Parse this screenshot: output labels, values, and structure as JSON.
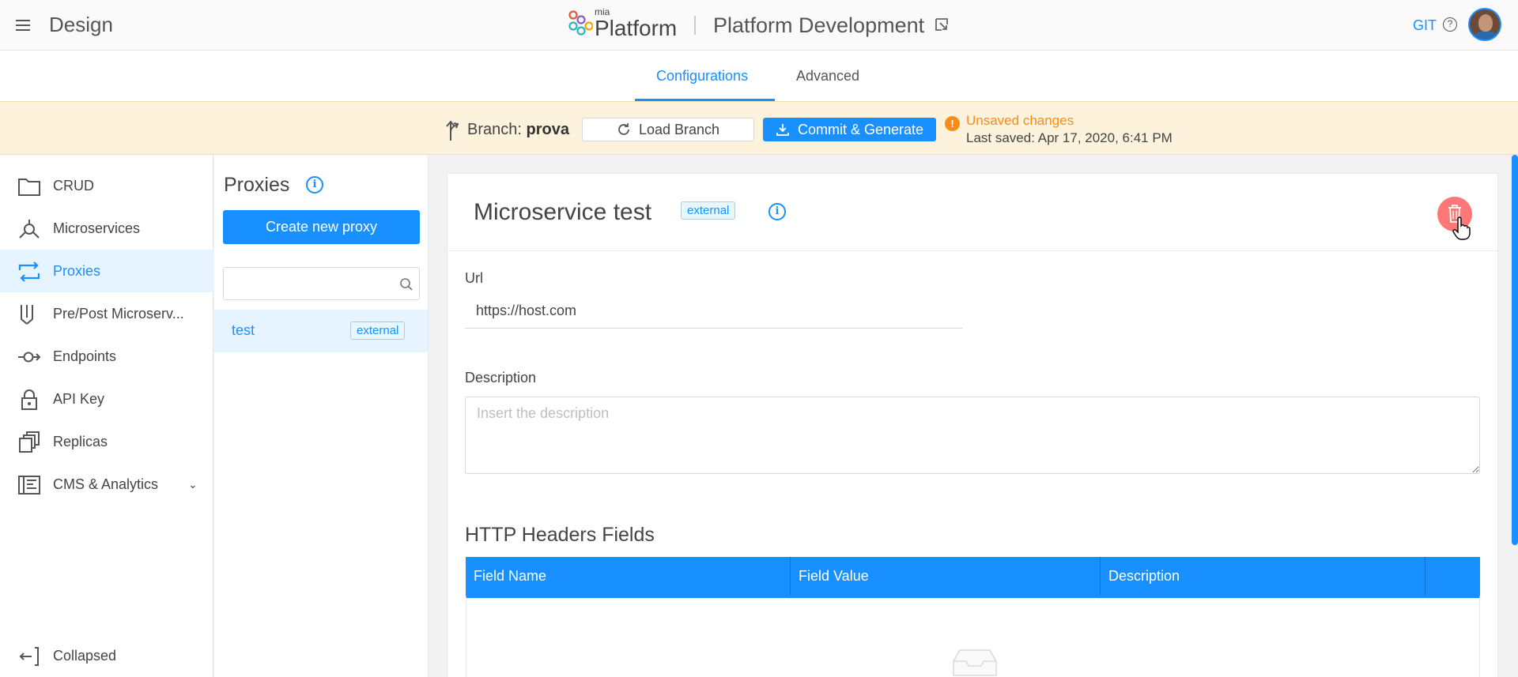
{
  "header": {
    "section_title": "Design",
    "logo_small": "mia",
    "logo_main": "Platform",
    "project_title": "Platform Development",
    "git_label": "GIT"
  },
  "tabs": [
    {
      "label": "Configurations",
      "active": true
    },
    {
      "label": "Advanced",
      "active": false
    }
  ],
  "branch_bar": {
    "branch_prefix": "Branch:",
    "branch_name": "prova",
    "load_branch_label": "Load Branch",
    "commit_label": "Commit & Generate",
    "unsaved_text": "Unsaved changes",
    "last_saved_text": "Last saved:  Apr 17, 2020, 6:41 PM"
  },
  "sidebar": {
    "items": [
      {
        "label": "CRUD",
        "icon": "folder-icon",
        "active": false
      },
      {
        "label": "Microservices",
        "icon": "microservices-icon",
        "active": false
      },
      {
        "label": "Proxies",
        "icon": "proxies-icon",
        "active": true
      },
      {
        "label": "Pre/Post Microserv...",
        "icon": "pre-post-icon",
        "active": false
      },
      {
        "label": "Endpoints",
        "icon": "endpoints-icon",
        "active": false
      },
      {
        "label": "API Key",
        "icon": "lock-icon",
        "active": false
      },
      {
        "label": "Replicas",
        "icon": "replicas-icon",
        "active": false
      },
      {
        "label": "CMS & Analytics",
        "icon": "cms-icon",
        "active": false
      }
    ],
    "collapse_label": "Collapsed"
  },
  "proxies": {
    "title": "Proxies",
    "create_label": "Create new proxy",
    "search_value": "",
    "list": [
      {
        "name": "test",
        "tag": "external"
      }
    ]
  },
  "detail": {
    "title": "Microservice test",
    "tag": "external",
    "url_label": "Url",
    "url_value": "https://host.com",
    "description_label": "Description",
    "description_placeholder": "Insert the description",
    "headers_title": "HTTP Headers Fields",
    "columns": [
      "Field Name",
      "Field Value",
      "Description",
      ""
    ]
  },
  "colors": {
    "accent": "#1890ff",
    "warning": "#fa8c16",
    "danger": "#ff7875",
    "branch_bar_bg": "#fdf3dd"
  }
}
